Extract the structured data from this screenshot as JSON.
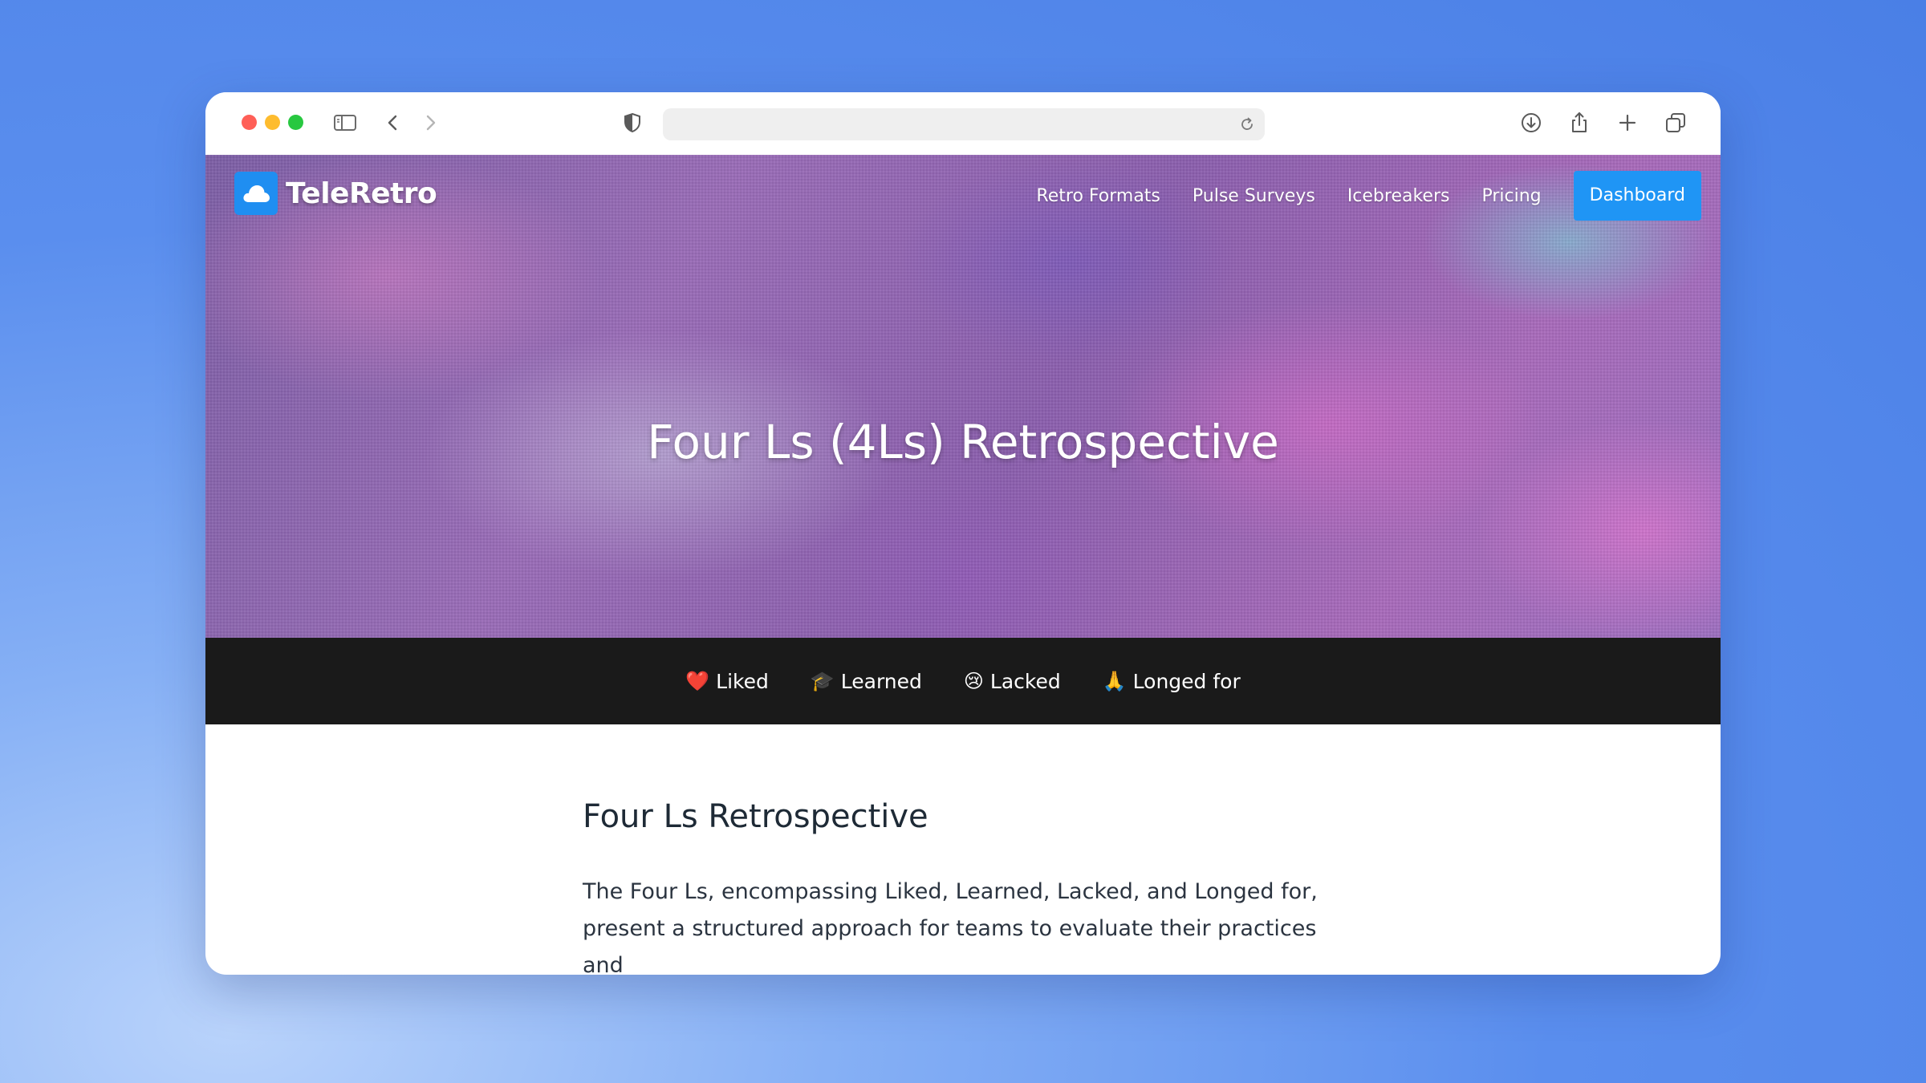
{
  "browser": {
    "icons": [
      "sidebar-icon",
      "back-icon",
      "forward-icon",
      "shield-icon",
      "reload-icon",
      "download-icon",
      "share-icon",
      "new-tab-icon",
      "tabs-overview-icon"
    ]
  },
  "site": {
    "brand": "TeleRetro",
    "nav": {
      "retro_formats": "Retro Formats",
      "pulse_surveys": "Pulse Surveys",
      "icebreakers": "Icebreakers",
      "pricing": "Pricing",
      "dashboard": "Dashboard"
    },
    "hero_title": "Four Ls (4Ls) Retrospective",
    "tabs": [
      {
        "emoji": "❤️",
        "label": "Liked"
      },
      {
        "emoji": "🎓",
        "label": "Learned"
      },
      {
        "emoji": "😢",
        "label": "Lacked"
      },
      {
        "emoji": "🙏",
        "label": "Longed for"
      }
    ],
    "section_title": "Four Ls Retrospective",
    "intro": "The Four Ls, encompassing Liked, Learned, Lacked, and Longed for, present a structured approach for teams to evaluate their practices and"
  },
  "colors": {
    "accent": "#1f95f5",
    "tabbar_bg": "#1a1a1a",
    "page_bg": "#5a8eee"
  }
}
